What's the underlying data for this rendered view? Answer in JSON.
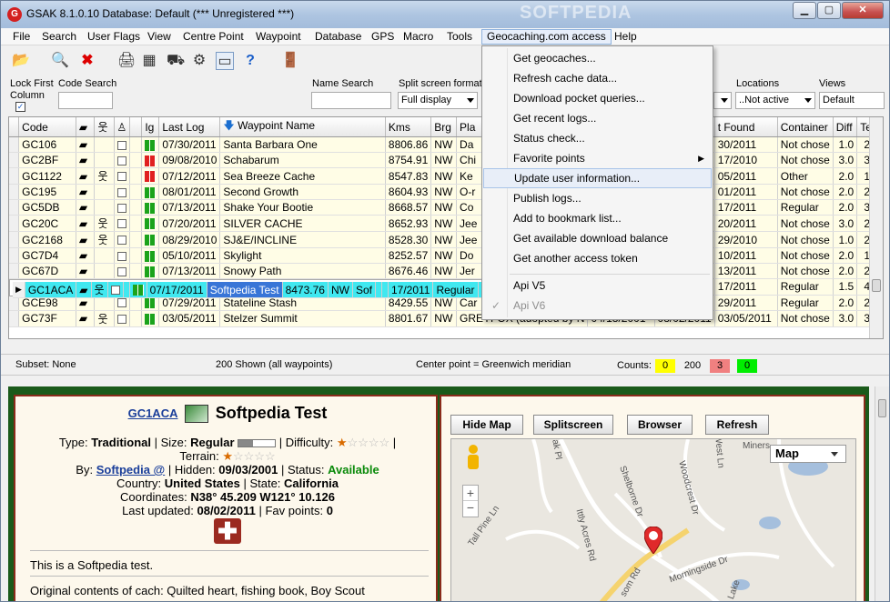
{
  "window": {
    "title": "GSAK 8.1.0.10    Database: Default    (*** Unregistered ***)",
    "watermark": "SOFTPEDIA"
  },
  "menu": [
    "File",
    "Search",
    "User Flags",
    "View",
    "Centre Point",
    "Waypoint",
    "Database",
    "GPS",
    "Macro",
    "Tools",
    "Geocaching.com access",
    "Help"
  ],
  "toolbar2": {
    "lock_first_column": "Lock First Column",
    "code_search": "Code Search",
    "name_search": "Name Search",
    "split_screen_format": "Split screen format",
    "split_screen_value": "Full display",
    "locations": "Locations",
    "locations_value": "..Not active",
    "views": "Views",
    "views_value": "Default"
  },
  "grid": {
    "columns": [
      "Code",
      "",
      "",
      "",
      "",
      "Ig",
      "Last Log",
      "Waypoint Name",
      "Kms",
      "Brg",
      "Pla",
      "",
      "t Found",
      "Container",
      "Diff",
      "Terr"
    ],
    "rows": [
      {
        "code": "GC106",
        "last": "07/30/2011",
        "name": "Santa Barbara One",
        "kms": "8806.86",
        "brg": "NW",
        "pla": "Da",
        "found": "30/2011",
        "cont": "Not chose",
        "diff": "1.0",
        "terr": "2.0"
      },
      {
        "code": "GC2BF",
        "last": "09/08/2010",
        "name": "Schabarum",
        "kms": "8754.91",
        "brg": "NW",
        "pla": "Chi",
        "found": "17/2010",
        "cont": "Not chose",
        "diff": "3.0",
        "terr": "3.0"
      },
      {
        "code": "GC1122",
        "last": "07/12/2011",
        "name": "Sea Breeze Cache",
        "kms": "8547.83",
        "brg": "NW",
        "pla": "Ke",
        "found": "05/2011",
        "cont": "Other",
        "diff": "2.0",
        "terr": "1.5"
      },
      {
        "code": "GC195",
        "last": "08/01/2011",
        "name": "Second Growth",
        "kms": "8604.93",
        "brg": "NW",
        "pla": "O-r",
        "found": "01/2011",
        "cont": "Not chose",
        "diff": "2.0",
        "terr": "2.0"
      },
      {
        "code": "GC5DB",
        "last": "07/13/2011",
        "name": "Shake Your Bootie",
        "kms": "8668.57",
        "brg": "NW",
        "pla": "Co",
        "found": "17/2011",
        "cont": "Regular",
        "diff": "2.0",
        "terr": "3.5"
      },
      {
        "code": "GC20C",
        "last": "07/20/2011",
        "name": "SILVER CACHE",
        "kms": "8652.93",
        "brg": "NW",
        "pla": "Jee",
        "found": "20/2011",
        "cont": "Not chose",
        "diff": "3.0",
        "terr": "2.0"
      },
      {
        "code": "GC2168",
        "last": "08/29/2010",
        "name": "SJ&E/INCLINE",
        "kms": "8528.30",
        "brg": "NW",
        "pla": "Jee",
        "found": "29/2010",
        "cont": "Not chose",
        "diff": "1.0",
        "terr": "2.0"
      },
      {
        "code": "GC7D4",
        "last": "05/10/2011",
        "name": "Skylight",
        "kms": "8252.57",
        "brg": "NW",
        "pla": "Do",
        "found": "10/2011",
        "cont": "Not chose",
        "diff": "2.0",
        "terr": "1.0"
      },
      {
        "code": "GC67D",
        "last": "07/13/2011",
        "name": "Snowy Path",
        "kms": "8676.46",
        "brg": "NW",
        "pla": "Jer",
        "found": "13/2011",
        "cont": "Not chose",
        "diff": "2.0",
        "terr": "2.0"
      },
      {
        "code": "GC1ACA",
        "last": "07/17/2011",
        "name": "Softpedia Test",
        "kms": "8473.76",
        "brg": "NW",
        "pla": "Sof",
        "found": "17/2011",
        "cont": "Regular",
        "diff": "1.0",
        "terr": "1.0"
      },
      {
        "code": "GC209F",
        "last": "04/17/2011",
        "name": "South Park Cyn/Lake Overview",
        "kms": "8531.48",
        "brg": "NW",
        "pla": "Jee",
        "found": "17/2011",
        "cont": "Regular",
        "diff": "1.5",
        "terr": "4.0"
      },
      {
        "code": "GCE98",
        "last": "07/29/2011",
        "name": "Stateline Stash",
        "kms": "8429.55",
        "brg": "NW",
        "pla": "Car",
        "found": "29/2011",
        "cont": "Regular",
        "diff": "2.0",
        "terr": "2.0"
      },
      {
        "code": "GC73F",
        "last": "03/05/2011",
        "name": "Stelzer Summit",
        "kms": "8801.67",
        "brg": "NW",
        "pla": "GREYFOX (adopted by N",
        "placed": "04/18/2001",
        "lastfound": "08/02/2011",
        "found": "03/05/2011",
        "cont": "Not chose",
        "diff": "3.0",
        "terr": "3.5"
      }
    ]
  },
  "status": {
    "subset": "Subset: None",
    "shown": "200 Shown (all waypoints)",
    "center": "Center point = Greenwich meridian",
    "counts_label": "Counts:",
    "c1": "0",
    "c2": "200",
    "c3": "3",
    "c4": "0"
  },
  "detail": {
    "code": "GC1ACA",
    "name": "Softpedia Test",
    "type_label": "Type:",
    "type": "Traditional",
    "size_label": "| Size:",
    "size": "Regular",
    "difficulty_label": "| Difficulty:",
    "terrain_label": "Terrain:",
    "by_label": "By:",
    "by": "Softpedia @",
    "hidden_label": "| Hidden:",
    "hidden": "09/03/2001",
    "status_label": "| Status:",
    "status": "Available",
    "country_label": "Country:",
    "country": "United States",
    "state_label": "| State:",
    "state": "California",
    "coords_label": "Coordinates:",
    "coords": "N38° 45.209 W121° 10.126",
    "updated_label": "Last updated:",
    "updated": "08/02/2011",
    "fav_label": "| Fav points:",
    "fav": "0",
    "desc": "This is a Softpedia test.",
    "original": "Original contents of cach: Quilted heart, fishing book, Boy Scout"
  },
  "map": {
    "hide_map": "Hide Map",
    "splitscreen": "Splitscreen",
    "browser": "Browser",
    "refresh": "Refresh",
    "map_type": "Map",
    "streets": [
      "Oak Pl",
      "Shelborne Dr",
      "Woodcrest Dr",
      "West Ln",
      "Miners",
      "Tall Pine Ln",
      "Ittly Acres Rd",
      "Morningside Dr",
      "som Rd",
      "Lake"
    ]
  },
  "dropdown": [
    {
      "label": "Get geocaches..."
    },
    {
      "label": "Refresh cache data..."
    },
    {
      "label": "Download pocket queries..."
    },
    {
      "label": "Get recent logs..."
    },
    {
      "label": "Status check..."
    },
    {
      "label": "Favorite points"
    },
    {
      "label": "Update user information..."
    },
    {
      "label": "Publish logs..."
    },
    {
      "label": "Add to bookmark list..."
    },
    {
      "label": "Get available download balance"
    },
    {
      "label": "Get another access token"
    },
    {
      "label": "Api V5"
    },
    {
      "label": "Api V6"
    }
  ]
}
